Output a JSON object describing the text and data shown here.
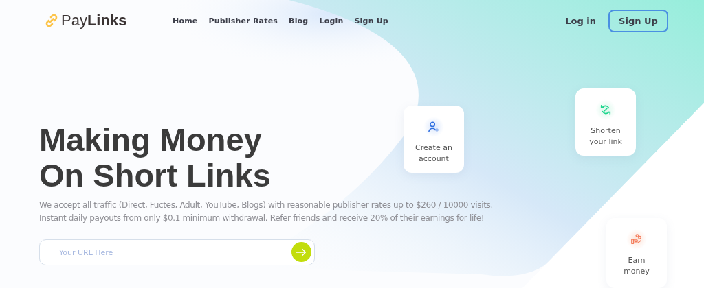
{
  "logo": {
    "text_light": "Pay",
    "text_bold": "Links"
  },
  "nav": [
    "Home",
    "Publisher Rates",
    "Blog",
    "Login",
    "Sign Up"
  ],
  "auth": {
    "login": "Log in",
    "signup": "Sign Up"
  },
  "hero": {
    "title_lines": [
      "Making Money",
      "On Short Links"
    ],
    "description_lines": [
      "We accept all traffic (Direct, Fuctes, Adult, YouTube, Blogs) with reasonable publisher rates up to $260 / 10000 visits.",
      "Instant daily payouts from only $0.1 minimum withdrawal. Refer friends and receive 20% of their earnings for life!"
    ],
    "url_field": {
      "placeholder": "Your URL Here"
    }
  },
  "steps": [
    {
      "kind": "account",
      "label": "Create an account"
    },
    {
      "kind": "shorten",
      "label": "Shorten your link"
    },
    {
      "kind": "earn",
      "label": "Earn money"
    }
  ]
}
